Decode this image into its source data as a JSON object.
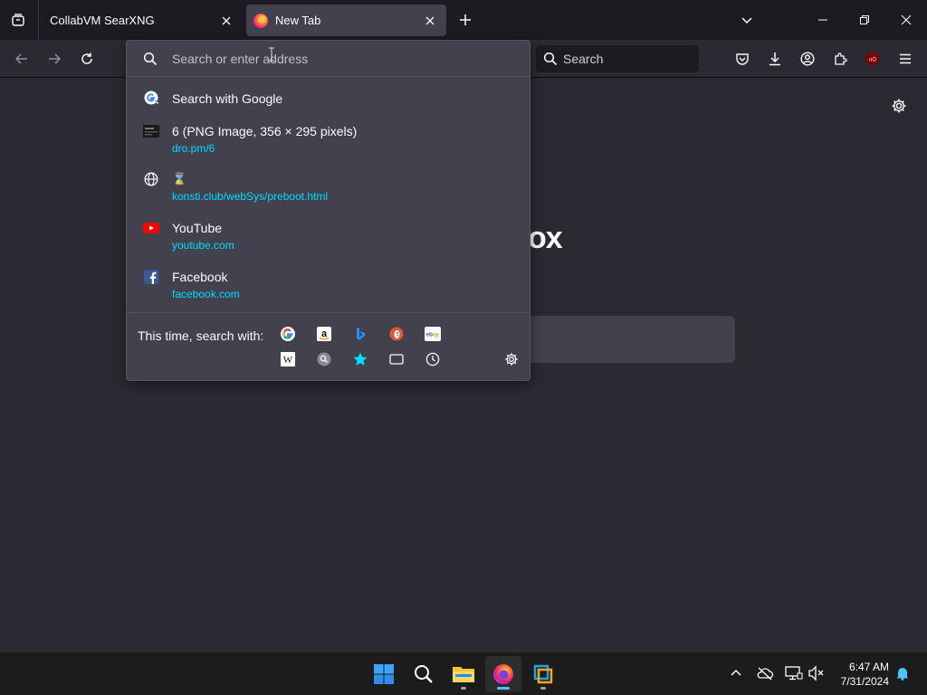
{
  "browser": {
    "tabs": [
      {
        "title": "CollabVM SearXNG",
        "active": false
      },
      {
        "title": "New Tab",
        "active": true
      }
    ],
    "toolbar": {
      "search_placeholder": "Search"
    },
    "icons": {
      "tab_list": "tab-list-icon",
      "new_tab": "plus-icon",
      "back": "arrow-left-icon",
      "forward": "arrow-right-icon",
      "reload": "reload-icon",
      "pocket": "pocket-icon",
      "downloads": "download-icon",
      "account": "account-icon",
      "extensions": "puzzle-icon",
      "ublock": "ublock-icon",
      "menu": "hamburger-icon"
    }
  },
  "urlbar": {
    "placeholder": "Search or enter address",
    "results": [
      {
        "title": "Search with Google",
        "url": "",
        "icon": "google-icon"
      },
      {
        "title": "6 (PNG Image, 356 × 295 pixels)",
        "url": "dro.pm/6",
        "icon": "image-thumb-icon"
      },
      {
        "title": "⌛",
        "url": "konsti.club/webSys/preboot.html",
        "icon": "globe-icon"
      },
      {
        "title": "YouTube",
        "url": "youtube.com",
        "icon": "youtube-icon"
      },
      {
        "title": "Facebook",
        "url": "facebook.com",
        "icon": "facebook-icon"
      }
    ],
    "one_off_label": "This time, search with:",
    "engines": [
      "Google",
      "Amazon",
      "Bing",
      "DuckDuckGo",
      "eBay",
      "Wikipedia",
      "SearXNG",
      "Bookmarks",
      "Tabs",
      "History"
    ]
  },
  "newtab": {
    "brand_fragment": "ox"
  },
  "taskbar": {
    "apps": [
      "Start",
      "Search",
      "File Explorer",
      "Firefox",
      "VirtualBox"
    ],
    "time": "6:47 AM",
    "date": "7/31/2024"
  },
  "colors": {
    "accent_link": "#00ddff",
    "taskbar_active": "#4cc2ff",
    "popup_bg": "#42414d",
    "page_bg": "#2b2a33"
  }
}
